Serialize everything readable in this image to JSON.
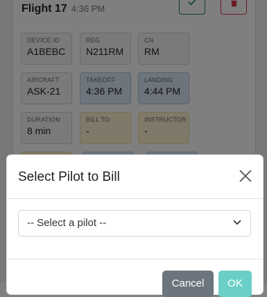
{
  "flight": {
    "title": "Flight 17",
    "time": "4:36 PM"
  },
  "tiles": [
    {
      "label": "DEVICE ID",
      "value": "A1BEBC"
    },
    {
      "label": "REG",
      "value": "N211RM"
    },
    {
      "label": "CN",
      "value": "RM"
    },
    {
      "label": "AIRCRAFT",
      "value": "ASK-21"
    },
    {
      "label": "TAKEOFF",
      "value": "4:36 PM"
    },
    {
      "label": "LANDING",
      "value": "4:44 PM"
    },
    {
      "label": "DURATION",
      "value": "8 min"
    },
    {
      "label": "BILL TO",
      "value": "-"
    },
    {
      "label": "INSTRUCTOR",
      "value": "-"
    }
  ],
  "modal": {
    "title": "Select Pilot to Bill",
    "select_value": "-- Select a pilot --",
    "cancel_label": "Cancel",
    "ok_label": "OK"
  },
  "icons": {
    "confirm": "check-icon",
    "delete": "trash-icon",
    "close": "close-icon",
    "dropdown": "chevron-down-icon"
  },
  "colors": {
    "success": "#198754",
    "danger": "#dc3545",
    "secondary": "#6c757d",
    "ok": "#6ccfc7",
    "tile_blue": "#dbe8f7",
    "tile_yellow": "#fdf3d2"
  }
}
